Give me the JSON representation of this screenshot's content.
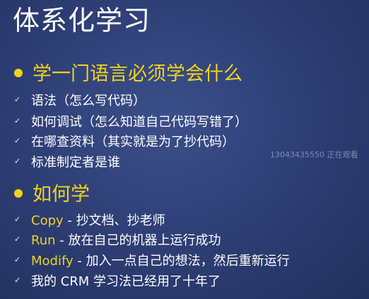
{
  "title": "体系化学习",
  "watermark": "13043435550 正在观看",
  "section1": {
    "heading": "学一门语言必须学会什么",
    "items": [
      "语法（怎么写代码）",
      "如何调试（怎么知道自己代码写错了）",
      "在哪查资料（其实就是为了抄代码）",
      "标准制定者是谁"
    ]
  },
  "section2": {
    "heading": "如何学",
    "items": [
      {
        "key": "Copy",
        "text": " - 抄文档、抄老师"
      },
      {
        "key": "Run",
        "text": " - 放在自己的机器上运行成功"
      },
      {
        "key": "Modify",
        "text": " - 加入一点自己的想法，然后重新运行"
      },
      {
        "key": "",
        "text": "我的 CRM 学习法已经用了十年了"
      }
    ]
  },
  "icons": {
    "bullet": "dot-bullet-icon",
    "check": "check-icon"
  },
  "colors": {
    "background": "#2c3d73",
    "heading": "#f3d21b",
    "text": "#ffffff"
  }
}
